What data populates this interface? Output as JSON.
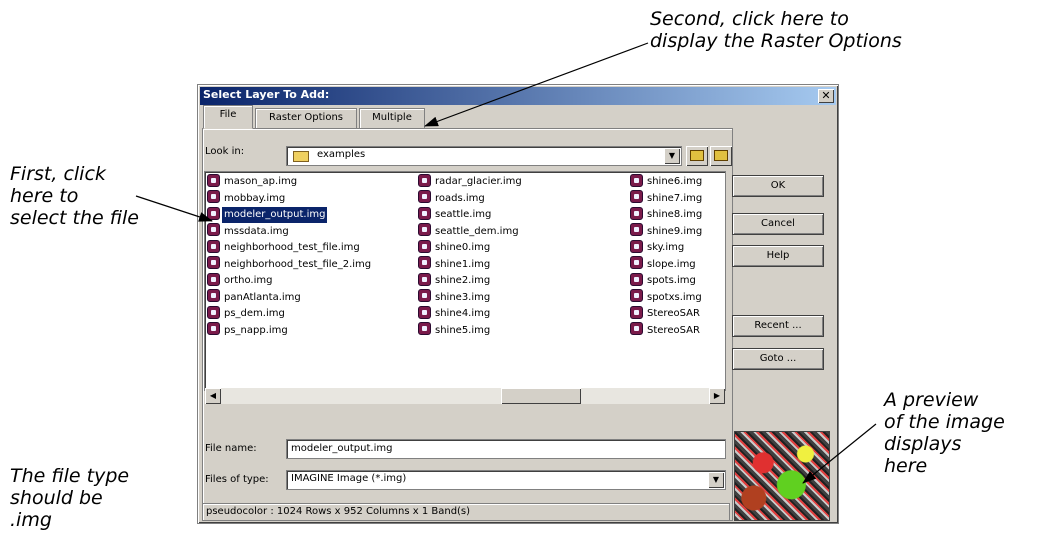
{
  "annotations": {
    "second": "Second, click here to\ndisplay the Raster Options",
    "first": "First, click\nhere to\nselect the file",
    "file_type": "The file type\nshould be\n.img",
    "preview": "A preview\nof the image\ndisplays\nhere"
  },
  "dialog": {
    "title": "Select Layer To Add:",
    "close_glyph": "✕",
    "tabs": [
      "File",
      "Raster Options",
      "Multiple"
    ],
    "active_tab": "File",
    "look_in_label": "Look in:",
    "look_in_value": "examples",
    "files": [
      {
        "name": "mason_ap.img"
      },
      {
        "name": "mobbay.img"
      },
      {
        "name": "modeler_output.img",
        "selected": true
      },
      {
        "name": "mssdata.img"
      },
      {
        "name": "neighborhood_test_file.img"
      },
      {
        "name": "neighborhood_test_file_2.img"
      },
      {
        "name": "ortho.img"
      },
      {
        "name": "panAtlanta.img"
      },
      {
        "name": "ps_dem.img"
      },
      {
        "name": "ps_napp.img"
      },
      {
        "name": "radar_glacier.img"
      },
      {
        "name": "roads.img"
      },
      {
        "name": "seattle.img"
      },
      {
        "name": "seattle_dem.img"
      },
      {
        "name": "shine0.img"
      },
      {
        "name": "shine1.img"
      },
      {
        "name": "shine2.img"
      },
      {
        "name": "shine3.img"
      },
      {
        "name": "shine4.img"
      },
      {
        "name": "shine5.img"
      },
      {
        "name": "shine6.img"
      },
      {
        "name": "shine7.img"
      },
      {
        "name": "shine8.img"
      },
      {
        "name": "shine9.img"
      },
      {
        "name": "sky.img"
      },
      {
        "name": "slope.img"
      },
      {
        "name": "spots.img"
      },
      {
        "name": "spotxs.img"
      },
      {
        "name": "StereoSAR"
      },
      {
        "name": "StereoSAR"
      }
    ],
    "file_name_label": "File name:",
    "file_name_value": "modeler_output.img",
    "files_of_type_label": "Files of type:",
    "files_of_type_value": "IMAGINE Image (*.img)",
    "status": "pseudocolor : 1024 Rows x 952 Columns x 1 Band(s)",
    "buttons": {
      "ok": "OK",
      "cancel": "Cancel",
      "help": "Help",
      "recent": "Recent ...",
      "goto": "Goto ..."
    },
    "scroll_left_glyph": "◀",
    "scroll_right_glyph": "▶",
    "dropdown_glyph": "▼"
  }
}
